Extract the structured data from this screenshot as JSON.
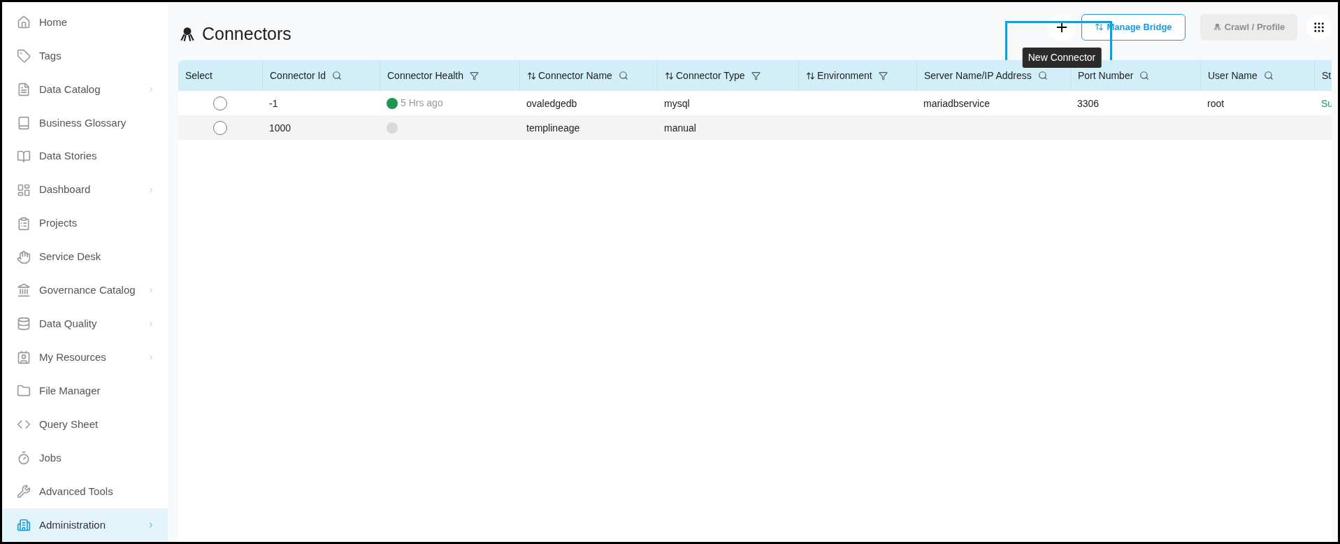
{
  "sidebar": {
    "items": [
      {
        "label": "Home",
        "submenu": false,
        "selected": false
      },
      {
        "label": "Tags",
        "submenu": false,
        "selected": false
      },
      {
        "label": "Data Catalog",
        "submenu": true,
        "selected": false
      },
      {
        "label": "Business Glossary",
        "submenu": false,
        "selected": false
      },
      {
        "label": "Data Stories",
        "submenu": false,
        "selected": false
      },
      {
        "label": "Dashboard",
        "submenu": true,
        "selected": false
      },
      {
        "label": "Projects",
        "submenu": false,
        "selected": false
      },
      {
        "label": "Service Desk",
        "submenu": false,
        "selected": false
      },
      {
        "label": "Governance Catalog",
        "submenu": true,
        "selected": false
      },
      {
        "label": "Data Quality",
        "submenu": true,
        "selected": false
      },
      {
        "label": "My Resources",
        "submenu": true,
        "selected": false
      },
      {
        "label": "File Manager",
        "submenu": false,
        "selected": false
      },
      {
        "label": "Query Sheet",
        "submenu": false,
        "selected": false
      },
      {
        "label": "Jobs",
        "submenu": false,
        "selected": false
      },
      {
        "label": "Advanced Tools",
        "submenu": false,
        "selected": false
      },
      {
        "label": "Administration",
        "submenu": true,
        "selected": true
      }
    ]
  },
  "page": {
    "title": "Connectors"
  },
  "toolbar": {
    "new_tooltip": "New Connector",
    "manage_bridge": {
      "label": "Manage Bridge",
      "disabled": false
    },
    "crawl_profile": {
      "label": "Crawl / Profile",
      "disabled": true
    }
  },
  "table": {
    "columns": [
      {
        "label": "Select",
        "sortable": false,
        "search": false,
        "filter": false
      },
      {
        "label": "Connector Id",
        "sortable": false,
        "search": true,
        "filter": false
      },
      {
        "label": "Connector Health",
        "sortable": false,
        "search": false,
        "filter": true
      },
      {
        "label": "Connector Name",
        "sortable": true,
        "search": true,
        "filter": false
      },
      {
        "label": "Connector Type",
        "sortable": true,
        "search": false,
        "filter": true
      },
      {
        "label": "Environment",
        "sortable": true,
        "search": false,
        "filter": true
      },
      {
        "label": "Server Name/IP Address",
        "sortable": false,
        "search": true,
        "filter": false
      },
      {
        "label": "Port Number",
        "sortable": false,
        "search": true,
        "filter": false
      },
      {
        "label": "User Name",
        "sortable": false,
        "search": true,
        "filter": false
      },
      {
        "label": "St"
      }
    ],
    "rows": [
      {
        "selected": false,
        "id": "-1",
        "health": {
          "color": "#1e9651",
          "text": "5 Hrs ago"
        },
        "name": "ovaledgedb",
        "type": "mysql",
        "server": "mariadbservice",
        "port": "3306",
        "user": "root",
        "status": "Su"
      },
      {
        "selected": false,
        "id": "1000",
        "health": {
          "color": "#d9d9d9"
        },
        "name": "templineage",
        "type": "manual"
      }
    ]
  }
}
